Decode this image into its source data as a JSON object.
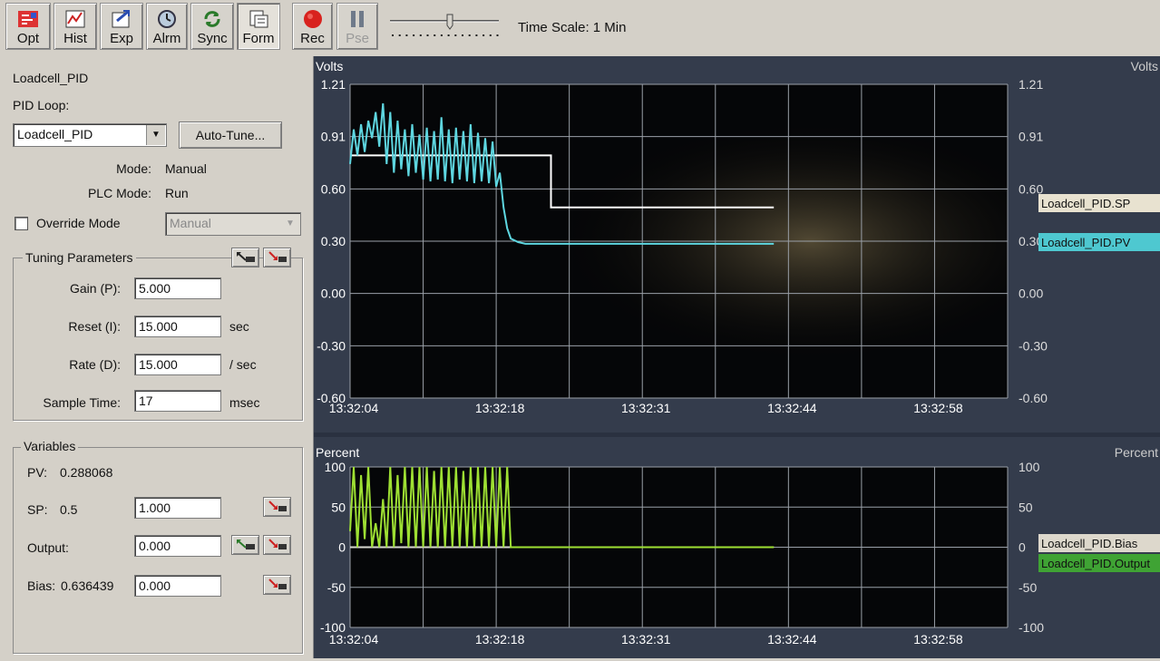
{
  "toolbar": {
    "buttons": [
      {
        "label": "Opt",
        "icon": "options-icon"
      },
      {
        "label": "Hist",
        "icon": "history-icon"
      },
      {
        "label": "Exp",
        "icon": "export-icon"
      },
      {
        "label": "Alrm",
        "icon": "alarm-icon"
      },
      {
        "label": "Sync",
        "icon": "sync-icon"
      },
      {
        "label": "Form",
        "icon": "form-icon"
      },
      {
        "label": "Rec",
        "icon": "record-icon"
      },
      {
        "label": "Pse",
        "icon": "pause-icon"
      }
    ],
    "time_scale": "Time Scale: 1 Min",
    "time_scale_slider": 0.55
  },
  "panel": {
    "title": "Loadcell_PID",
    "pid_loop_label": "PID Loop:",
    "pid_loop_value": "Loadcell_PID",
    "autotune_label": "Auto-Tune...",
    "mode_label": "Mode:",
    "mode_value": "Manual",
    "plc_mode_label": "PLC Mode:",
    "plc_mode_value": "Run",
    "override_label": "Override Mode",
    "override_checked": false,
    "override_select": "Manual",
    "tuning": {
      "title": "Tuning Parameters",
      "gain_label": "Gain (P):",
      "gain_value": "5.000",
      "reset_label": "Reset (I):",
      "reset_value": "15.000",
      "reset_unit": "sec",
      "rate_label": "Rate (D):",
      "rate_value": "15.000",
      "rate_unit": "/ sec",
      "sample_label": "Sample Time:",
      "sample_value": "17",
      "sample_unit": "msec"
    },
    "variables": {
      "title": "Variables",
      "pv_label": "PV:",
      "pv_value": "0.288068",
      "sp_label": "SP:",
      "sp_value": "0.5",
      "sp_input": "1.000",
      "output_label": "Output:",
      "output_input": "0.000",
      "bias_label": "Bias:",
      "bias_value": "0.636439",
      "bias_input": "0.000"
    }
  },
  "chart_data": [
    {
      "type": "line",
      "ylabel": "Volts",
      "ylabel_right": "Volts",
      "ylim": [
        -0.6,
        1.21
      ],
      "yticks": [
        "1.21",
        "0.91",
        "0.60",
        "0.30",
        "0.00",
        "-0.30",
        "-0.60"
      ],
      "xticks": [
        "13:32:04",
        "13:32:18",
        "13:32:31",
        "13:32:44",
        "13:32:58"
      ],
      "series": [
        {
          "name": "Loadcell_PID.SP",
          "color": "#ffffff",
          "x": [
            0,
            0.5,
            1.0,
            1.5,
            2.0,
            2.5,
            2.75,
            2.75,
            3.0,
            3.5,
            4.0,
            4.5,
            5.0,
            5.5,
            5.8
          ],
          "y": [
            0.8,
            0.8,
            0.8,
            0.8,
            0.8,
            0.8,
            0.8,
            0.5,
            0.5,
            0.5,
            0.5,
            0.5,
            0.5,
            0.5,
            0.5
          ]
        },
        {
          "name": "Loadcell_PID.PV",
          "color": "#5ed6e0",
          "x": [
            0,
            0.05,
            0.1,
            0.15,
            0.2,
            0.25,
            0.3,
            0.35,
            0.4,
            0.45,
            0.5,
            0.55,
            0.6,
            0.65,
            0.7,
            0.75,
            0.8,
            0.85,
            0.9,
            0.95,
            1.0,
            1.05,
            1.1,
            1.15,
            1.2,
            1.25,
            1.3,
            1.35,
            1.4,
            1.45,
            1.5,
            1.55,
            1.6,
            1.65,
            1.7,
            1.75,
            1.8,
            1.85,
            1.9,
            1.95,
            2.0,
            2.05,
            2.1,
            2.15,
            2.2,
            2.3,
            2.4,
            2.6,
            3.0,
            3.5,
            4.0,
            4.5,
            5.0,
            5.5,
            5.8
          ],
          "y": [
            0.75,
            0.95,
            0.8,
            0.98,
            0.82,
            1.0,
            0.9,
            1.05,
            0.85,
            1.1,
            0.75,
            1.05,
            0.7,
            1.0,
            0.72,
            0.95,
            0.68,
            0.98,
            0.7,
            0.92,
            0.66,
            0.96,
            0.65,
            0.94,
            0.66,
            1.02,
            0.65,
            0.95,
            0.64,
            0.96,
            0.66,
            0.94,
            0.65,
            0.98,
            0.64,
            0.93,
            0.65,
            0.9,
            0.64,
            0.88,
            0.62,
            0.7,
            0.5,
            0.38,
            0.32,
            0.3,
            0.29,
            0.29,
            0.29,
            0.29,
            0.29,
            0.29,
            0.29,
            0.29,
            0.29
          ]
        }
      ]
    },
    {
      "type": "line",
      "ylabel": "Percent",
      "ylabel_right": "Percent",
      "ylim": [
        -100,
        100
      ],
      "yticks": [
        "100",
        "50",
        "0",
        "-50",
        "-100"
      ],
      "xticks": [
        "13:32:04",
        "13:32:18",
        "13:32:31",
        "13:32:44",
        "13:32:58"
      ],
      "series": [
        {
          "name": "Loadcell_PID.Bias",
          "color": "#d8d8d0",
          "x": [
            0,
            5.8
          ],
          "y": [
            0,
            0
          ]
        },
        {
          "name": "Loadcell_PID.Output",
          "color": "#9ee033",
          "x": [
            0,
            0.05,
            0.1,
            0.15,
            0.2,
            0.25,
            0.3,
            0.35,
            0.4,
            0.45,
            0.5,
            0.55,
            0.6,
            0.65,
            0.7,
            0.75,
            0.8,
            0.85,
            0.9,
            0.95,
            1.0,
            1.05,
            1.1,
            1.15,
            1.2,
            1.25,
            1.3,
            1.35,
            1.4,
            1.45,
            1.5,
            1.55,
            1.6,
            1.65,
            1.7,
            1.75,
            1.8,
            1.85,
            1.9,
            1.95,
            2.0,
            2.05,
            2.1,
            2.15,
            2.2,
            2.3,
            3.0,
            4.0,
            5.0,
            5.8
          ],
          "y": [
            20,
            100,
            0,
            90,
            10,
            100,
            0,
            30,
            0,
            60,
            0,
            100,
            0,
            90,
            5,
            100,
            0,
            100,
            0,
            100,
            0,
            100,
            0,
            95,
            0,
            100,
            0,
            100,
            0,
            100,
            0,
            95,
            0,
            100,
            0,
            100,
            0,
            100,
            0,
            100,
            0,
            100,
            0,
            100,
            0,
            0,
            0,
            0,
            0,
            0
          ]
        }
      ]
    }
  ]
}
